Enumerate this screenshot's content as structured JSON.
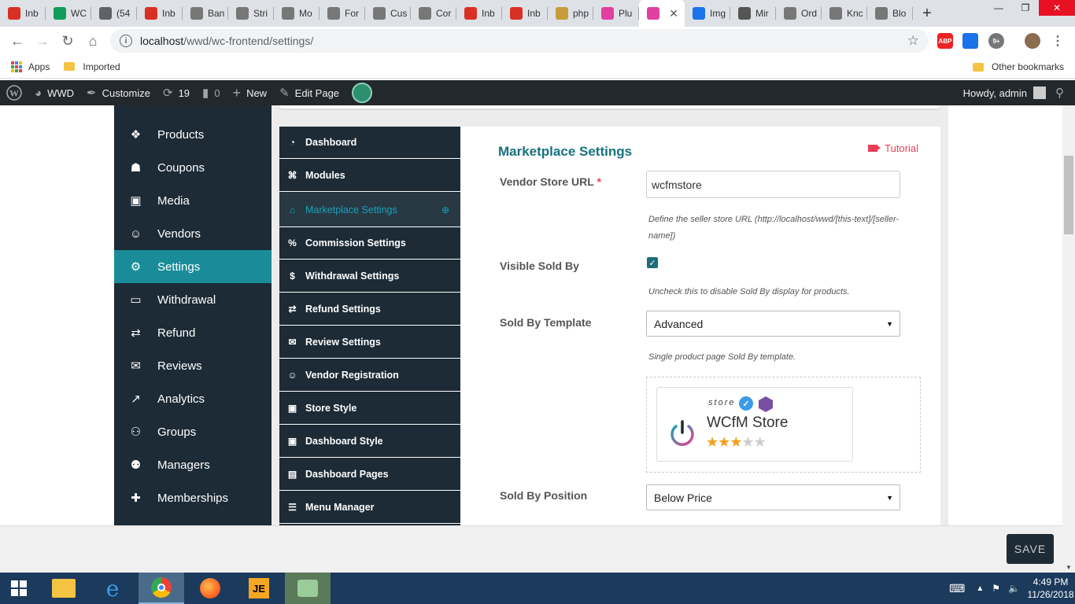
{
  "browser": {
    "tabs": [
      {
        "label": "Inb",
        "icon": "gmail-icon",
        "color": "#d93025"
      },
      {
        "label": "WC",
        "icon": "sheets-icon",
        "color": "#0f9d58"
      },
      {
        "label": "(54",
        "icon": "chat-icon",
        "color": "#5f6368"
      },
      {
        "label": "Inb",
        "icon": "gmail-icon",
        "color": "#d93025"
      },
      {
        "label": "Ban",
        "icon": "wcfm-icon",
        "color": "#777"
      },
      {
        "label": "Stri",
        "icon": "wcfm-icon",
        "color": "#777"
      },
      {
        "label": "Mo",
        "icon": "wcfm-icon",
        "color": "#777"
      },
      {
        "label": "For",
        "icon": "wcfm-icon",
        "color": "#777"
      },
      {
        "label": "Cus",
        "icon": "wcfm-icon",
        "color": "#777"
      },
      {
        "label": "Cor",
        "icon": "wcfm-icon",
        "color": "#777"
      },
      {
        "label": "Inb",
        "icon": "gmail-icon",
        "color": "#d93025"
      },
      {
        "label": "Inb",
        "icon": "gmail-icon",
        "color": "#d93025"
      },
      {
        "label": "php",
        "icon": "php-icon",
        "color": "#c89b3c"
      },
      {
        "label": "Plu",
        "icon": "plugin-icon",
        "color": "#e040a0"
      },
      {
        "label": "",
        "icon": "wcfm-icon",
        "color": "#e040a0",
        "active": true
      },
      {
        "label": "Img",
        "icon": "ibb-icon",
        "color": "#1a73e8"
      },
      {
        "label": "Mir",
        "icon": "film-icon",
        "color": "#555"
      },
      {
        "label": "Ord",
        "icon": "wcfm-icon",
        "color": "#777"
      },
      {
        "label": "Knc",
        "icon": "wcfm-icon",
        "color": "#777"
      },
      {
        "label": "Blo",
        "icon": "wcfm-icon",
        "color": "#777"
      }
    ],
    "url_host": "localhost",
    "url_path": "/wwd/wc-frontend/settings/",
    "bookmarks": {
      "apps": "Apps",
      "imported": "Imported",
      "other": "Other bookmarks"
    }
  },
  "adminbar": {
    "site": "WWD",
    "customize": "Customize",
    "updates": "19",
    "comments": "0",
    "new": "New",
    "edit_page": "Edit Page",
    "howdy": "Howdy, admin"
  },
  "leftmenu": {
    "items": [
      {
        "label": "Products",
        "icon": "products-icon"
      },
      {
        "label": "Coupons",
        "icon": "gift-icon"
      },
      {
        "label": "Media",
        "icon": "image-icon"
      },
      {
        "label": "Vendors",
        "icon": "user-icon"
      },
      {
        "label": "Settings",
        "icon": "gears-icon",
        "active": true
      },
      {
        "label": "Withdrawal",
        "icon": "credit-card-icon"
      },
      {
        "label": "Refund",
        "icon": "exchange-icon"
      },
      {
        "label": "Reviews",
        "icon": "comments-icon"
      },
      {
        "label": "Analytics",
        "icon": "chart-line-icon"
      },
      {
        "label": "Groups",
        "icon": "users-icon"
      },
      {
        "label": "Managers",
        "icon": "user-secret-icon"
      },
      {
        "label": "Memberships",
        "icon": "user-plus-icon"
      }
    ]
  },
  "submenu": {
    "items": [
      {
        "label": "Dashboard",
        "icon": "dashboard-icon"
      },
      {
        "label": "Modules",
        "icon": "modules-icon"
      },
      {
        "label": "Marketplace Settings",
        "icon": "home-icon",
        "active": true
      },
      {
        "label": "Commission Settings",
        "icon": "percent-icon"
      },
      {
        "label": "Withdrawal Settings",
        "icon": "dollar-icon"
      },
      {
        "label": "Refund Settings",
        "icon": "exchange-icon"
      },
      {
        "label": "Review Settings",
        "icon": "comments-icon"
      },
      {
        "label": "Vendor Registration",
        "icon": "user-icon"
      },
      {
        "label": "Store Style",
        "icon": "image-icon"
      },
      {
        "label": "Dashboard Style",
        "icon": "image-icon"
      },
      {
        "label": "Dashboard Pages",
        "icon": "pages-icon"
      },
      {
        "label": "Menu Manager",
        "icon": "menu-icon"
      }
    ]
  },
  "panel": {
    "title": "Marketplace Settings",
    "tutorial": "Tutorial",
    "vendor_store_url": {
      "label": "Vendor Store URL",
      "required": "*",
      "value": "wcfmstore",
      "help": "Define the seller store URL (http://localhost/wwd/[this-text]/[seller-name])"
    },
    "visible_sold_by": {
      "label": "Visible Sold By",
      "checked": true,
      "help": "Uncheck this to disable Sold By display for products."
    },
    "sold_by_template": {
      "label": "Sold By Template",
      "value": "Advanced",
      "help": "Single product page Sold By template."
    },
    "preview": {
      "store_word": "store",
      "store_name": "WCfM Store",
      "rating_stars": 2.5,
      "rating_max": 5
    },
    "sold_by_position": {
      "label": "Sold By Position",
      "value": "Below Price"
    },
    "save_label": "SAVE"
  },
  "taskbar": {
    "time": "4:49 PM",
    "date": "11/26/2018"
  }
}
